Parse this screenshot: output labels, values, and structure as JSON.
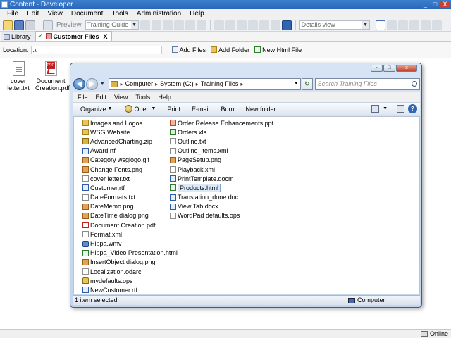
{
  "app": {
    "title": "Content - Developer",
    "window_buttons": [
      "_",
      "□",
      "X"
    ]
  },
  "menu": [
    "File",
    "Edit",
    "View",
    "Document",
    "Tools",
    "Administration",
    "Help"
  ],
  "toolbar": {
    "preview_label": "Preview",
    "guide_value": "Training Guide",
    "view_value": "Details view"
  },
  "tabs": [
    {
      "label": "Library",
      "active": false
    },
    {
      "label": "Customer Files",
      "active": true,
      "close": "X"
    }
  ],
  "location": {
    "label": "Location:",
    "value": ".\\",
    "add_files": "Add Files",
    "add_folder": "Add Folder",
    "new_html": "New Html File"
  },
  "desktop_files": [
    {
      "label": "cover letter.txt",
      "icon": "text-file-icon"
    },
    {
      "label": "Document Creation.pdf",
      "icon": "pdf-file-icon",
      "tag": "PDF"
    }
  ],
  "status": {
    "online": "Online"
  },
  "explorer": {
    "window_buttons": [
      "-",
      "□",
      "x"
    ],
    "address": [
      "Computer",
      "System (C:)",
      "Training Files"
    ],
    "search_placeholder": "Search Training Files",
    "menu": [
      "File",
      "Edit",
      "View",
      "Tools",
      "Help"
    ],
    "commands": {
      "organize": "Organize",
      "open": "Open",
      "print": "Print",
      "email": "E-mail",
      "burn": "Burn",
      "new_folder": "New folder"
    },
    "files_col1": [
      {
        "name": "Images and Logos",
        "type": "folder"
      },
      {
        "name": "WSG Website",
        "type": "folder"
      },
      {
        "name": "AdvancedCharting.zip",
        "type": "zip"
      },
      {
        "name": "Award.rtf",
        "type": "word"
      },
      {
        "name": "Category wsglogo.gif",
        "type": "image"
      },
      {
        "name": "Change Fonts.png",
        "type": "image"
      },
      {
        "name": "cover letter.txt",
        "type": "text"
      },
      {
        "name": "Customer.rtf",
        "type": "word"
      },
      {
        "name": "DateFormats.txt",
        "type": "text"
      },
      {
        "name": "DateMemo.png",
        "type": "image"
      },
      {
        "name": "DateTime dialog.png",
        "type": "image"
      },
      {
        "name": "Document Creation.pdf",
        "type": "pdf"
      },
      {
        "name": "Format.xml",
        "type": "text"
      },
      {
        "name": "Hippa.wmv",
        "type": "media"
      },
      {
        "name": "Hippa_Video Presentation.html",
        "type": "html"
      },
      {
        "name": "InsertObject dialog.png",
        "type": "image"
      },
      {
        "name": "Localization.odarc",
        "type": "generic"
      },
      {
        "name": "mydefaults.ops",
        "type": "lock"
      },
      {
        "name": "NewCustomer.rtf",
        "type": "word"
      }
    ],
    "files_col2": [
      {
        "name": "Order Release Enhancements.ppt",
        "type": "ppt"
      },
      {
        "name": "Orders.xls",
        "type": "excel"
      },
      {
        "name": "Outline.txt",
        "type": "text"
      },
      {
        "name": "Outline_items.xml",
        "type": "text"
      },
      {
        "name": "PageSetup.png",
        "type": "image"
      },
      {
        "name": "Playback.xml",
        "type": "text"
      },
      {
        "name": "PrintTemplate.docm",
        "type": "word"
      },
      {
        "name": "Products.html",
        "type": "html",
        "selected": true
      },
      {
        "name": "Translation_done.doc",
        "type": "word"
      },
      {
        "name": "View Tab.docx",
        "type": "word"
      },
      {
        "name": "WordPad defaults.ops",
        "type": "generic"
      }
    ],
    "status": {
      "selected": "1 item selected",
      "location": "Computer"
    }
  },
  "colors": {
    "titlebar": "#2a66b9",
    "selection": "#dbe8f8",
    "explorer_frame": "#c1d5ec"
  }
}
